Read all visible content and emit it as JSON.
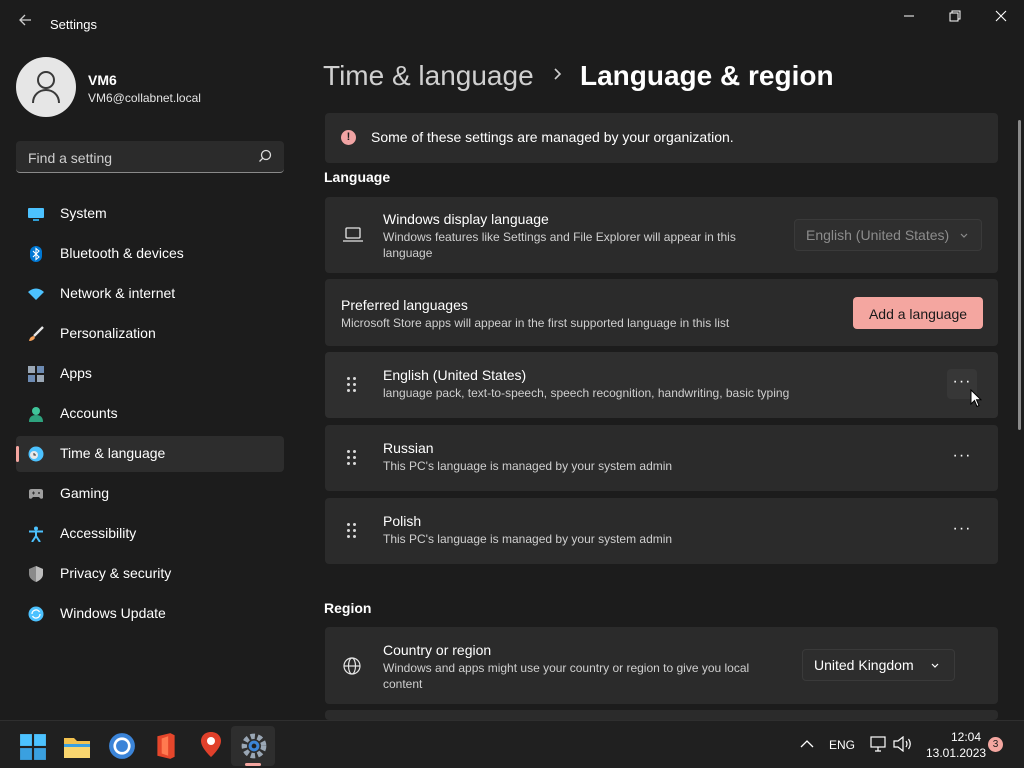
{
  "window": {
    "title": "Settings",
    "minimize_glyph": "—",
    "maximize_glyph": "❐",
    "close_glyph": "✕"
  },
  "profile": {
    "name": "VM6",
    "email": "VM6@collabnet.local"
  },
  "search": {
    "placeholder": "Find a setting"
  },
  "nav": {
    "items": [
      {
        "label": "System",
        "icon": "system-icon",
        "color": "#4cc2ff"
      },
      {
        "label": "Bluetooth & devices",
        "icon": "bluetooth-icon",
        "color": "#0078d4"
      },
      {
        "label": "Network & internet",
        "icon": "wifi-icon",
        "color": "#4cc2ff"
      },
      {
        "label": "Personalization",
        "icon": "paintbrush-icon",
        "color": "#f7a35c"
      },
      {
        "label": "Apps",
        "icon": "apps-icon",
        "color": "#9aa7b5"
      },
      {
        "label": "Accounts",
        "icon": "accounts-icon",
        "color": "#3fc59a"
      },
      {
        "label": "Time & language",
        "icon": "globe-clock-icon",
        "color": "#4cc2ff",
        "active": true
      },
      {
        "label": "Gaming",
        "icon": "gamepad-icon",
        "color": "#a0a0a0"
      },
      {
        "label": "Accessibility",
        "icon": "accessibility-icon",
        "color": "#4cc2ff"
      },
      {
        "label": "Privacy & security",
        "icon": "shield-icon",
        "color": "#8a8a8a"
      },
      {
        "label": "Windows Update",
        "icon": "update-icon",
        "color": "#4cc2ff"
      }
    ]
  },
  "header": {
    "parent": "Time & language",
    "separator": "›",
    "current": "Language & region"
  },
  "info_bar": {
    "icon": "!",
    "text": "Some of these settings are managed by your organization."
  },
  "language_section": {
    "label": "Language",
    "display_language": {
      "title": "Windows display language",
      "subtitle_line1": "Windows features like Settings and File Explorer will appear in this",
      "subtitle_line2": "language",
      "value": "English (United States)",
      "disabled": true
    },
    "preferred": {
      "title": "Preferred languages",
      "subtitle": "Microsoft Store apps will appear in the first supported language in this list",
      "button": "Add a language"
    },
    "languages": [
      {
        "name": "English (United States)",
        "detail": "language pack, text-to-speech, speech recognition, handwriting, basic typing",
        "more": "···"
      },
      {
        "name": "Russian",
        "detail": "This PC's language is managed by your system admin",
        "more": "···"
      },
      {
        "name": "Polish",
        "detail": "This PC's language is managed by your system admin",
        "more": "···"
      }
    ]
  },
  "region_section": {
    "label": "Region",
    "country": {
      "title": "Country or region",
      "subtitle_line1": "Windows and apps might use your country or region to give you local",
      "subtitle_line2": "content",
      "value": "United Kingdom"
    }
  },
  "taskbar": {
    "apps": [
      "windows-start-icon",
      "file-explorer-icon",
      "chrome-icon",
      "office-icon",
      "maps-icon",
      "settings-icon"
    ],
    "tray": {
      "chevron": "^",
      "lang": "ENG",
      "time": "12:04",
      "date": "13.01.2023",
      "notifications": "3"
    }
  },
  "colors": {
    "accent": "#f4a6a0",
    "background": "#1c1c1c",
    "card": "#2b2b2b"
  }
}
